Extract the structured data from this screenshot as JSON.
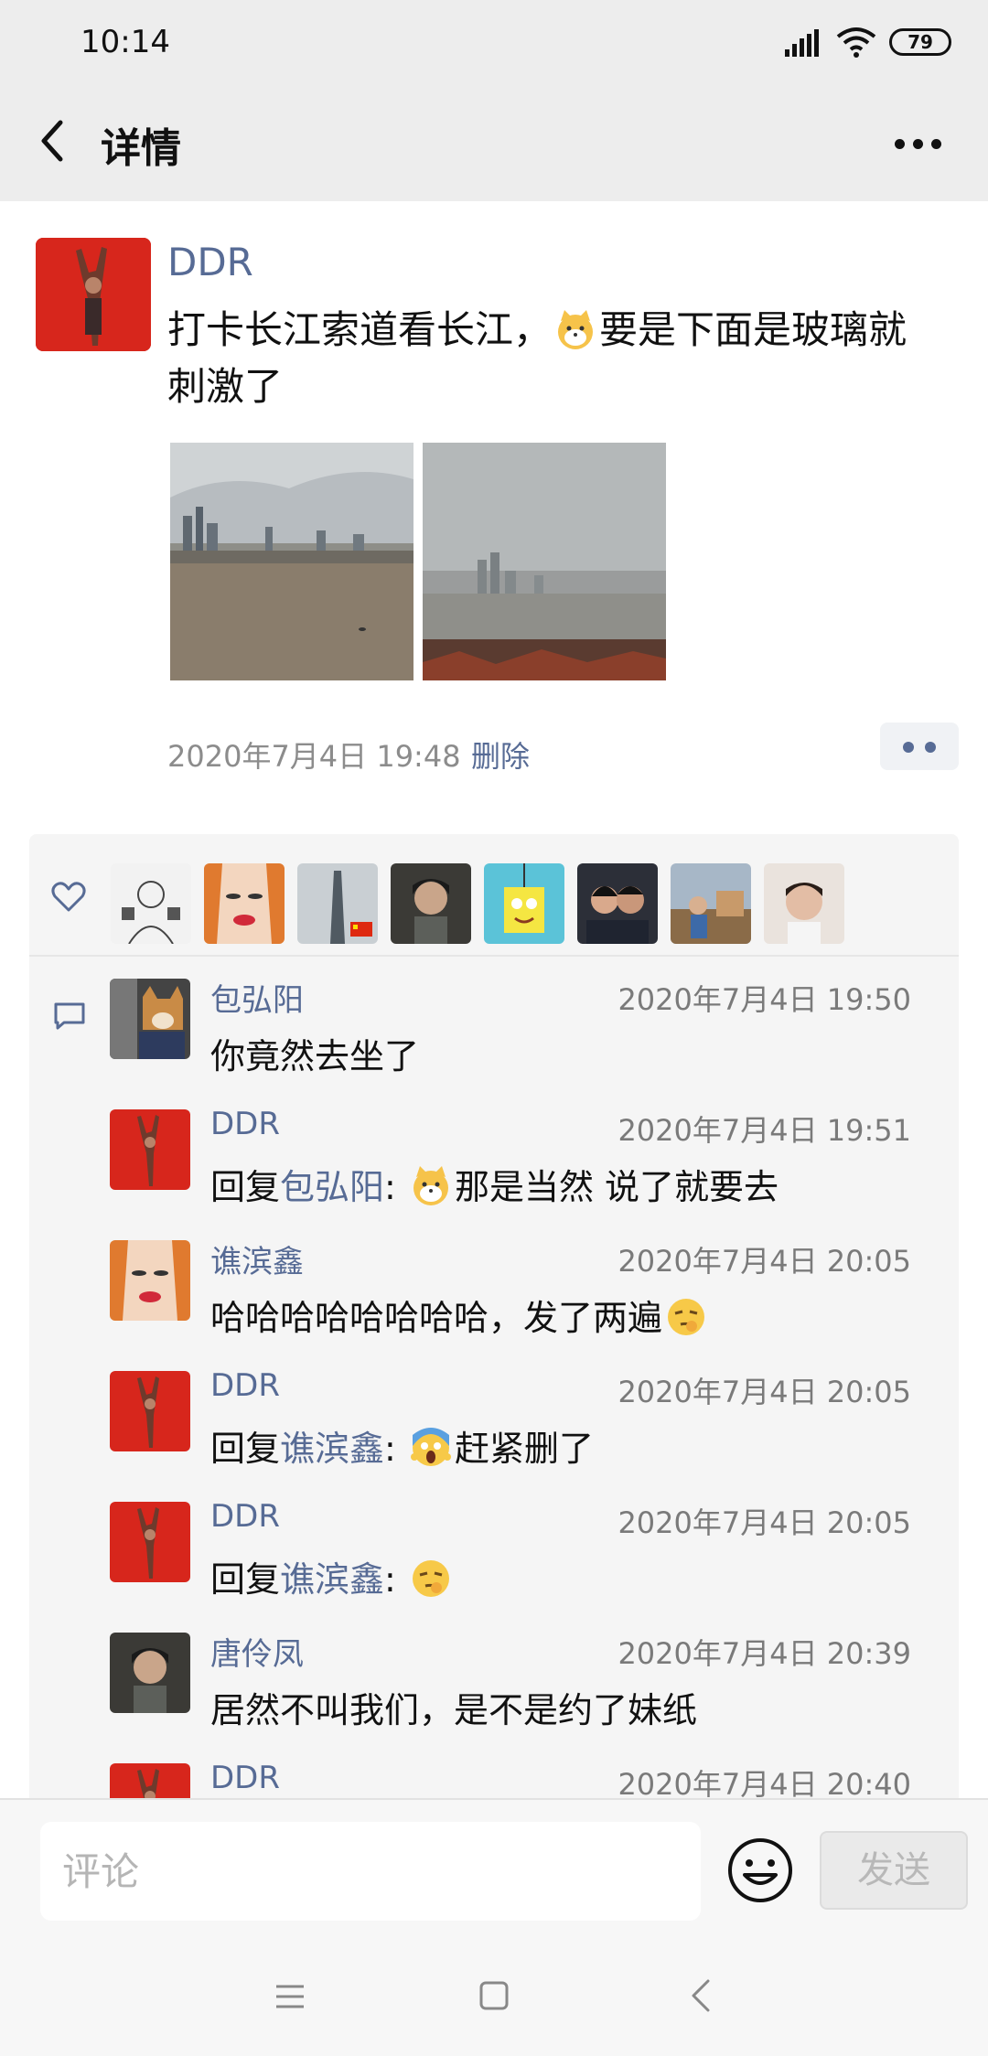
{
  "status_bar": {
    "time": "10:14",
    "battery": "79"
  },
  "header": {
    "title": "详情"
  },
  "post": {
    "author": "DDR",
    "text_part1": "打卡长江索道看长江，",
    "text_part2": "要是下面是玻璃就刺激了",
    "timestamp": "2020年7月4日 19:48",
    "delete_label": "删除"
  },
  "likes": {
    "avatar_names": [
      "sketch-avatar",
      "cartoon-face-avatar",
      "tower-flag-avatar",
      "girl-avatar",
      "spongebob-avatar",
      "couple-avatar",
      "outdoor-avatar",
      "boy-avatar"
    ]
  },
  "comments": [
    {
      "name": "包弘阳",
      "time": "2020年7月4日 19:50",
      "text": "你竟然去坐了"
    },
    {
      "name": "DDR",
      "time": "2020年7月4日 19:51",
      "reply_prefix": "回复",
      "reply_to": "包弘阳",
      "reply_sep": ":",
      "text": "那是当然  说了就要去"
    },
    {
      "name": "谯滨鑫",
      "time": "2020年7月4日 20:05",
      "text": "哈哈哈哈哈哈哈哈，发了两遍"
    },
    {
      "name": "DDR",
      "time": "2020年7月4日 20:05",
      "reply_prefix": "回复",
      "reply_to": "谯滨鑫",
      "reply_sep": ":",
      "text": "赶紧删了"
    },
    {
      "name": "DDR",
      "time": "2020年7月4日 20:05",
      "reply_prefix": "回复",
      "reply_to": "谯滨鑫",
      "reply_sep": ":",
      "text": ""
    },
    {
      "name": "唐伶凤",
      "time": "2020年7月4日 20:39",
      "text": "居然不叫我们，是不是约了妹纸"
    },
    {
      "name": "DDR",
      "time": "2020年7月4日 20:40",
      "text": ""
    }
  ],
  "comment_box": {
    "placeholder": "评论",
    "send_label": "发送"
  },
  "colors": {
    "link": "#576b95",
    "panel": "#f5f5f5",
    "bar": "#ededed"
  }
}
